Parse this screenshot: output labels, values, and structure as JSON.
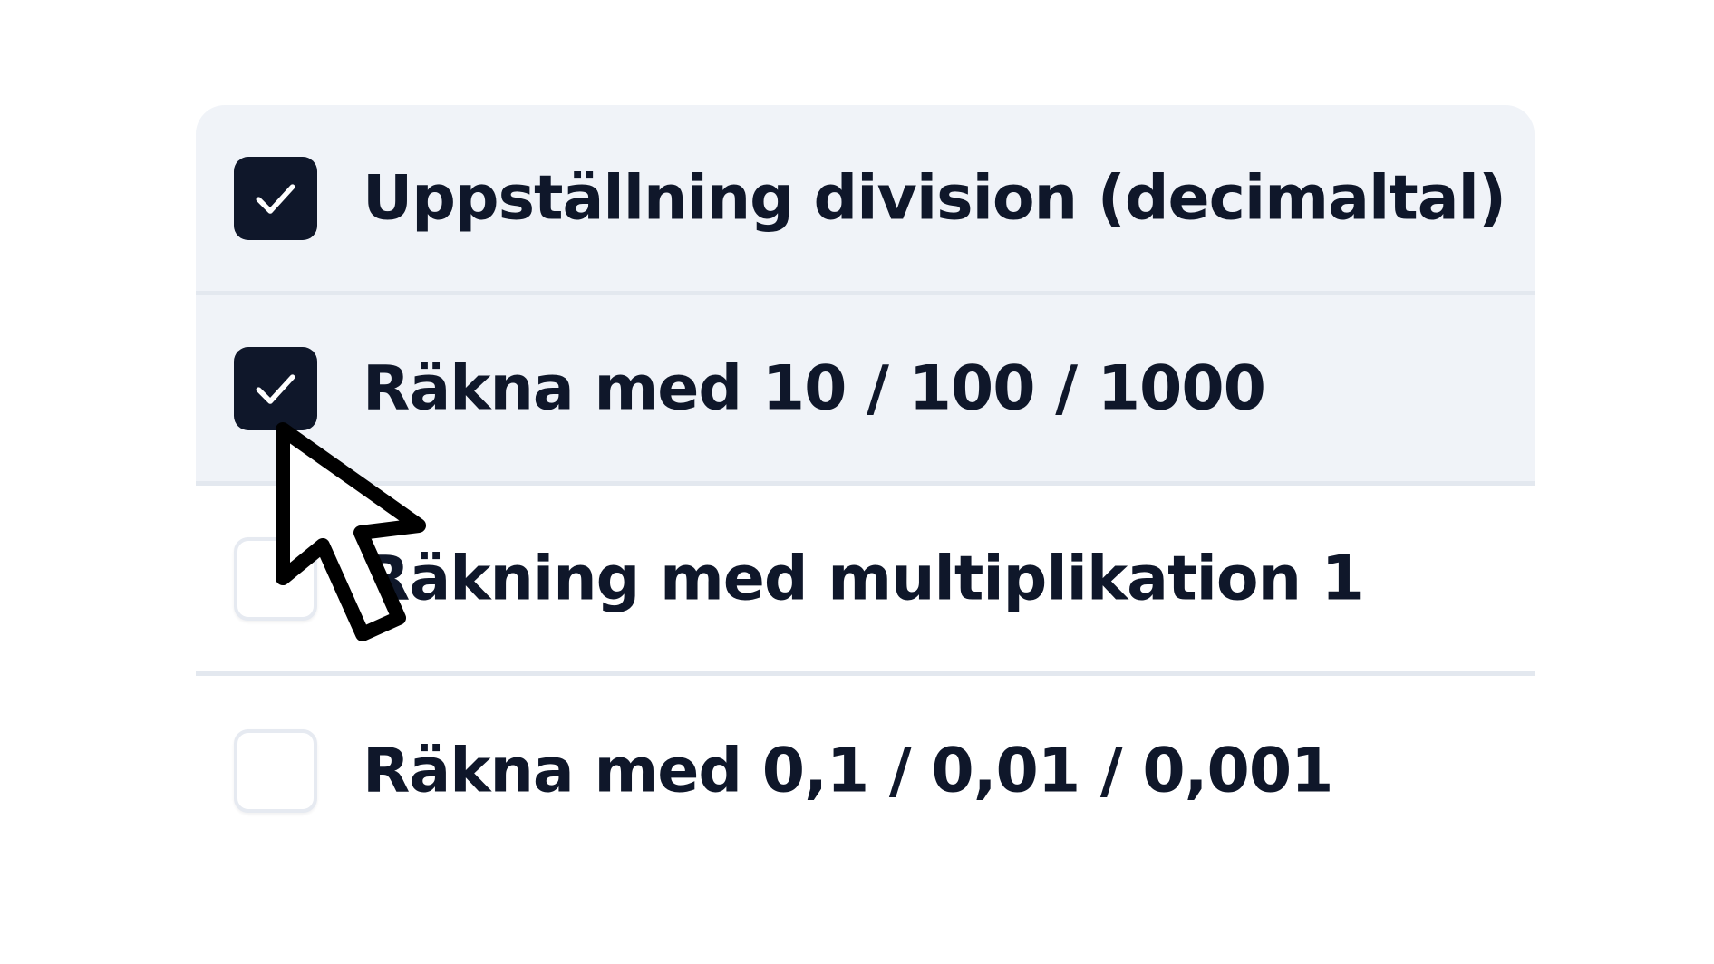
{
  "options": [
    {
      "label": "Uppställning division (decimaltal)",
      "checked": true,
      "icon": "checkmark-icon"
    },
    {
      "label": "Räkna med 10 / 100 / 1000",
      "checked": true,
      "icon": "checkmark-icon"
    },
    {
      "label": "Räkning med multiplikation 1",
      "checked": false
    },
    {
      "label": "Räkna med 0,1 / 0,01 / 0,001",
      "checked": false
    }
  ],
  "colors": {
    "selected_background": "#f0f3f8",
    "checkbox_checked": "#0f172a",
    "text": "#0f172a",
    "divider": "#e3e8ef"
  },
  "cursor": {
    "icon": "mouse-pointer-icon"
  }
}
